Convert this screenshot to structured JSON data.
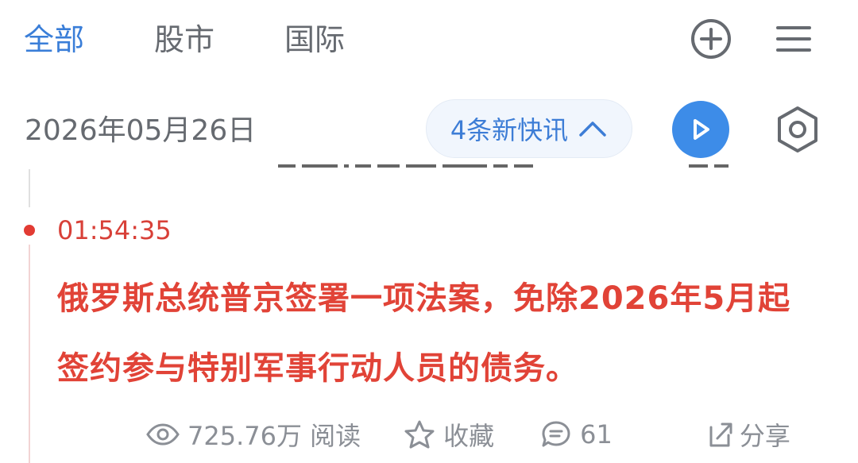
{
  "tabs": [
    {
      "label": "全部",
      "active": true
    },
    {
      "label": "股市",
      "active": false
    },
    {
      "label": "国际",
      "active": false
    }
  ],
  "top_actions": {
    "add_icon": "plus-circle-icon",
    "menu_icon": "hamburger-menu-icon"
  },
  "date": "2026年05月26日",
  "news_pill": {
    "label": "4条新快讯",
    "icon": "chevron-up-icon"
  },
  "controls": {
    "play_icon": "play-icon",
    "settings_icon": "settings-hexagon-icon"
  },
  "item": {
    "time": "01:54:35",
    "headline": "俄罗斯总统普京签署一项法案，免除2026年5月起签约参与特别军事行动人员的债务。",
    "actions": {
      "views": "725.76万 阅读",
      "favorite": "收藏",
      "comments": "61",
      "share_partial": "分享"
    }
  },
  "colors": {
    "active_tab": "#3a7ed8",
    "headline_red": "#e14337",
    "time_red": "#d84038",
    "play_blue": "#3d8ce8",
    "muted_text": "#8b8f96"
  }
}
